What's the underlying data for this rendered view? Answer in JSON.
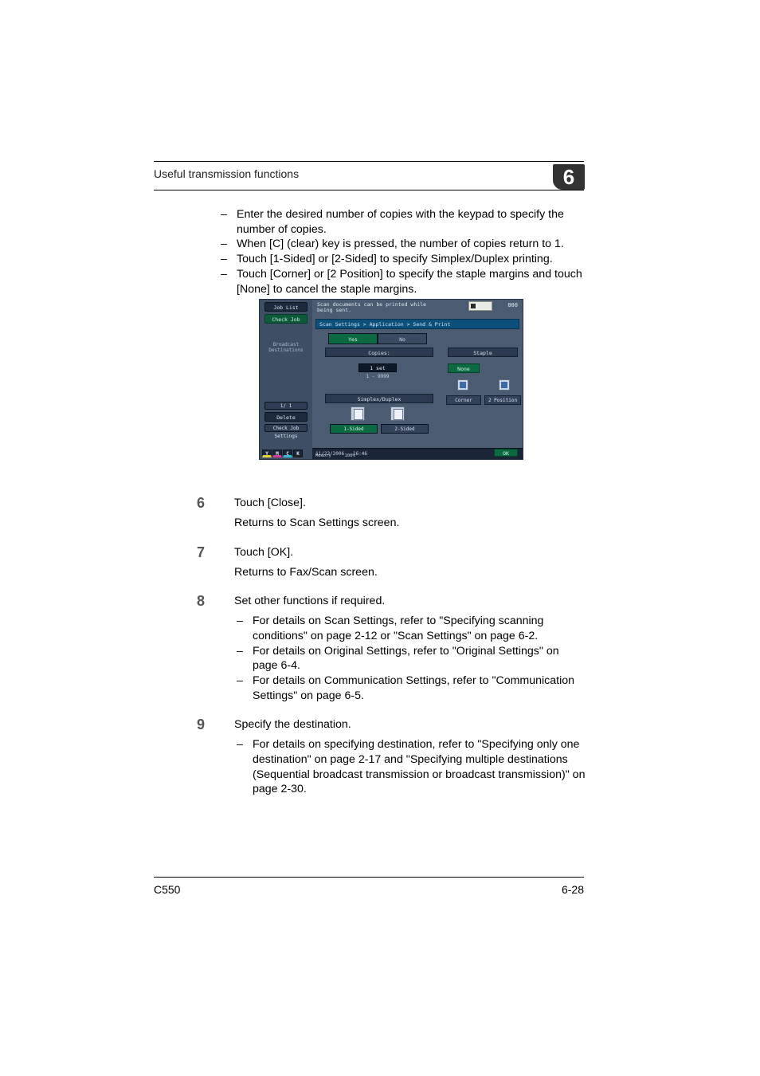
{
  "header": {
    "title": "Useful transmission functions",
    "chapter": "6"
  },
  "footer": {
    "left": "C550",
    "right": "6-28"
  },
  "intro_bullets": [
    "Enter the desired number of copies with the keypad to specify the number of copies.",
    "When [C] (clear) key is pressed, the number of copies return to 1.",
    "Touch [1-Sided] or [2-Sided] to specify Simplex/Duplex printing.",
    "Touch [Corner] or [2 Position] to specify the staple margins and touch [None] to cancel the staple margins."
  ],
  "steps": {
    "s6": {
      "num": "6",
      "text": "Touch [Close].",
      "sub": "Returns to Scan Settings screen."
    },
    "s7": {
      "num": "7",
      "text": "Touch [OK].",
      "sub": "Returns to Fax/Scan screen."
    },
    "s8": {
      "num": "8",
      "text": "Set other functions if required.",
      "bullets": [
        "For details on Scan Settings, refer to \"Specifying scanning conditions\" on page 2-12 or \"Scan Settings\" on page 6-2.",
        "For details on Original Settings, refer to \"Original Settings\" on page 6-4.",
        "For details on Communication Settings, refer to \"Communication Settings\" on page 6-5."
      ]
    },
    "s9": {
      "num": "9",
      "text": "Specify the destination.",
      "bullets": [
        "For details on specifying destination, refer to \"Specifying only one destination\" on page 2-17 and \"Specifying multiple destinations (Sequential broadcast transmission or broadcast transmission)\" on page 2-30."
      ]
    }
  },
  "screenshot": {
    "left_col": {
      "job_list": "Job List",
      "check_job": "Check Job",
      "broadcast": "Broadcast\nDestinations",
      "page": "1/ 1",
      "delete": "Delete",
      "check_settings": "Check Job\nSettings"
    },
    "msg_line1": "Scan documents can be printed while",
    "msg_line2": "being sent.",
    "dest_count": "000",
    "breadcrumb": "Scan Settings > Application > Send & Print",
    "yes": "Yes",
    "no": "No",
    "copies_head": "Copies:",
    "copies_val": "1 set",
    "copies_range": "1  -  9999",
    "simplex_head": "Simplex/Duplex",
    "one_sided": "1-Sided",
    "two_sided": "2-Sided",
    "staple_head": "Staple",
    "none": "None",
    "corner": "Corner",
    "two_position": "2 Position",
    "ok": "OK",
    "footer_date": "11/23/2006",
    "footer_time": "16:46",
    "footer_mem": "Memory",
    "footer_mem_val": "100%",
    "ymck": {
      "y": "Y",
      "m": "M",
      "c": "C",
      "k": "K"
    }
  }
}
